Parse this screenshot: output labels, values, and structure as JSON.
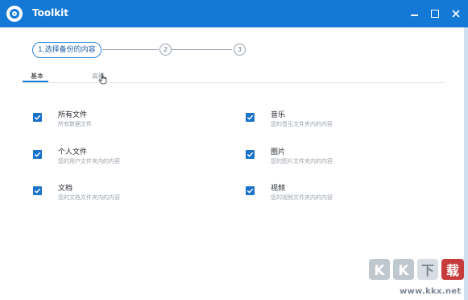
{
  "window": {
    "title": "Toolkit",
    "accent": "#1478d6"
  },
  "stepper": {
    "step1_label": "1.选择备份的内容",
    "step2_label": "2",
    "step3_label": "3"
  },
  "tabs": [
    {
      "label": "基本",
      "active": true
    },
    {
      "label": "高级",
      "active": false
    }
  ],
  "options": [
    {
      "title": "所有文件",
      "desc": "所有数据文件",
      "checked": true
    },
    {
      "title": "音乐",
      "desc": "您的音乐文件夹内的内容",
      "checked": true
    },
    {
      "title": "个人文件",
      "desc": "您的用户文件夹内的内容",
      "checked": true
    },
    {
      "title": "图片",
      "desc": "您的图片文件夹内的内容",
      "checked": true
    },
    {
      "title": "文档",
      "desc": "您的文档文件夹内的内容",
      "checked": true
    },
    {
      "title": "视频",
      "desc": "您的视频文件夹内的内容",
      "checked": true
    }
  ],
  "watermark": {
    "logo_text": "KK下载",
    "url": "www.kkx.net"
  }
}
